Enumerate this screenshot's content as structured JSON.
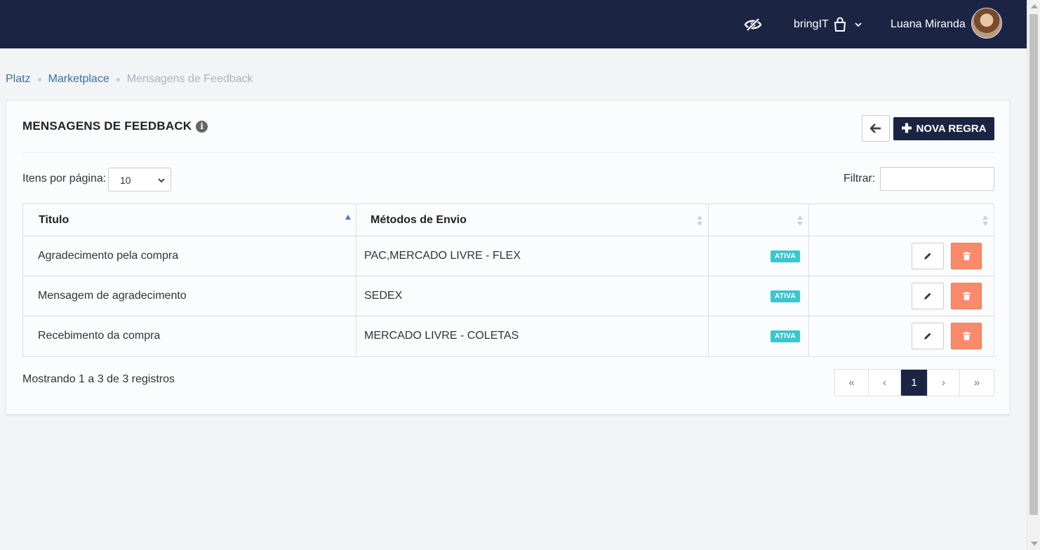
{
  "header": {
    "company": "bringIT",
    "user_name": "Luana Miranda",
    "bg_color": "#1c2444"
  },
  "breadcrumb": {
    "items": [
      "Platz",
      "Marketplace",
      "Mensagens de Feedback"
    ]
  },
  "card": {
    "title": "MENSAGENS DE FEEDBACK",
    "new_button_label": "NOVA REGRA",
    "per_page_label": "Itens por página:",
    "per_page_value": "10",
    "filter_label": "Filtrar:",
    "filter_value": ""
  },
  "table": {
    "headers": [
      "Titulo",
      "Métodos de Envio",
      "",
      ""
    ],
    "rows": [
      {
        "titulo": "Agradecimento pela compra",
        "metodos": "PAC,MERCADO LIVRE - FLEX",
        "status": "ATIVA"
      },
      {
        "titulo": "Mensagem de agradecimento",
        "metodos": "SEDEX",
        "status": "ATIVA"
      },
      {
        "titulo": "Recebimento da compra",
        "metodos": "MERCADO LIVRE - COLETAS",
        "status": "ATIVA"
      }
    ]
  },
  "footer": {
    "showing": "Mostrando 1 a 3 de 3 registros",
    "pagination": {
      "first": "«",
      "prev": "‹",
      "current": "1",
      "next": "›",
      "last": "»"
    }
  },
  "colors": {
    "badge": "#3bc5d0",
    "delete": "#fa8a6b",
    "primary": "#1c2444",
    "link": "#3a6ea5"
  }
}
